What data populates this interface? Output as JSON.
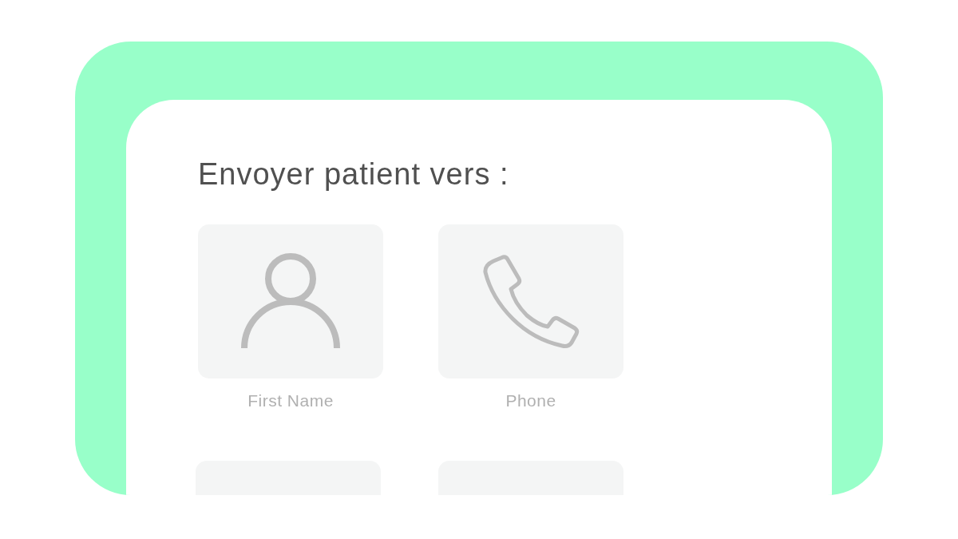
{
  "heading": "Envoyer patient vers :",
  "tiles": [
    {
      "kind": "person",
      "label": "First Name"
    },
    {
      "kind": "phone",
      "label": "Phone"
    },
    {
      "kind": "blank"
    },
    {
      "kind": "blank"
    }
  ]
}
